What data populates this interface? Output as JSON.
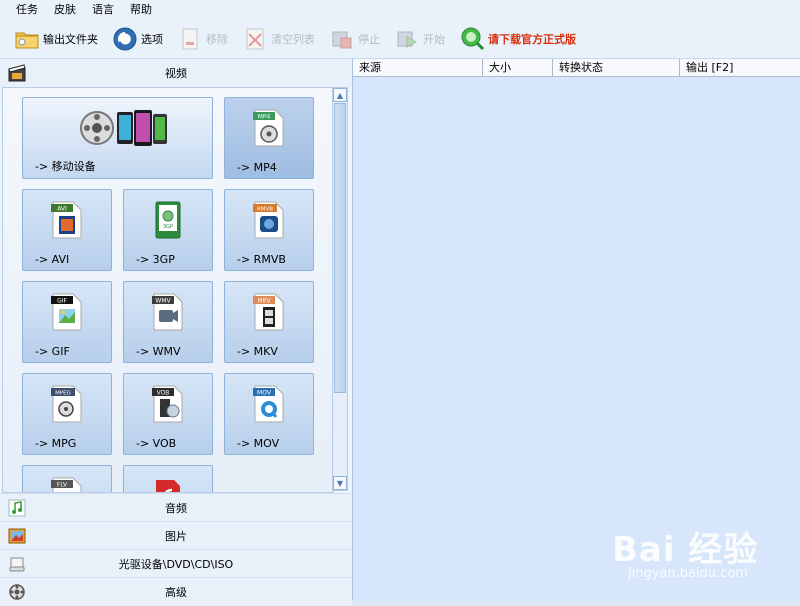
{
  "menu": [
    "任务",
    "皮肤",
    "语言",
    "帮助"
  ],
  "toolbar": {
    "output_folder": "输出文件夹",
    "options": "选项",
    "remove": "移除",
    "clear_list": "清空列表",
    "stop": "停止",
    "start": "开始",
    "promo": "请下载官方正式版"
  },
  "left_panel": {
    "video_header": "视频",
    "tiles": [
      {
        "label": "-> 移动设备"
      },
      {
        "label": "-> MP4",
        "badge": "MP4"
      },
      {
        "label": "-> AVI",
        "badge": "AVI"
      },
      {
        "label": "-> 3GP",
        "badge": "3GP"
      },
      {
        "label": "-> RMVB",
        "badge": "RMVB"
      },
      {
        "label": "-> GIF",
        "badge": "GIF"
      },
      {
        "label": "-> WMV",
        "badge": "WMV"
      },
      {
        "label": "-> MKV",
        "badge": "MKV"
      },
      {
        "label": "-> MPG",
        "badge": "MPEG"
      },
      {
        "label": "-> VOB",
        "badge": "VOB"
      },
      {
        "label": "-> MOV",
        "badge": "MOV"
      },
      {
        "label": "",
        "badge": "FLV"
      },
      {
        "label": "",
        "badge": ""
      }
    ],
    "categories": [
      "音频",
      "图片",
      "光驱设备\\DVD\\CD\\ISO",
      "高级"
    ]
  },
  "file_list": {
    "columns": [
      "来源",
      "大小",
      "转换状态",
      "输出 [F2]"
    ]
  },
  "watermark": {
    "line1": "Bai 经验",
    "line2": "jingyan.baidu.com"
  },
  "colors": {
    "accent": "#4a78b0",
    "promo": "#d9310f",
    "list_bg": "#d7e6fa"
  }
}
